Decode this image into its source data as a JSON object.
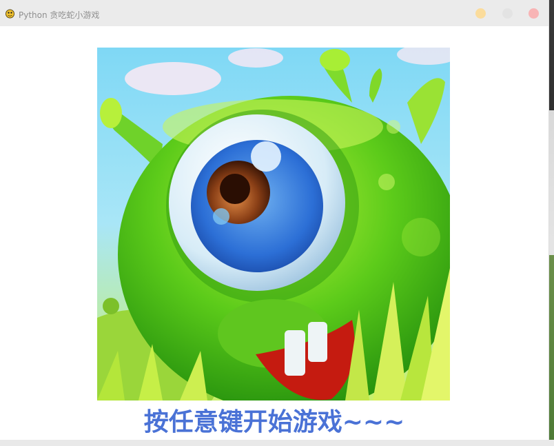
{
  "window": {
    "title": "Python 贪吃蛇小游戏",
    "app_icon": "pygame-snake-icon",
    "controls": {
      "minimize": "minimize-button",
      "maximize": "maximize-button",
      "close": "close-button"
    },
    "control_colors": {
      "minimize": "#fbdc9c",
      "maximize": "#e3e3e3",
      "close": "#f8b4b5"
    }
  },
  "game": {
    "splash_image": "green-one-eyed-monster",
    "start_prompt": "按任意键开始游戏~~~",
    "prompt_color": "#4a72d6"
  }
}
